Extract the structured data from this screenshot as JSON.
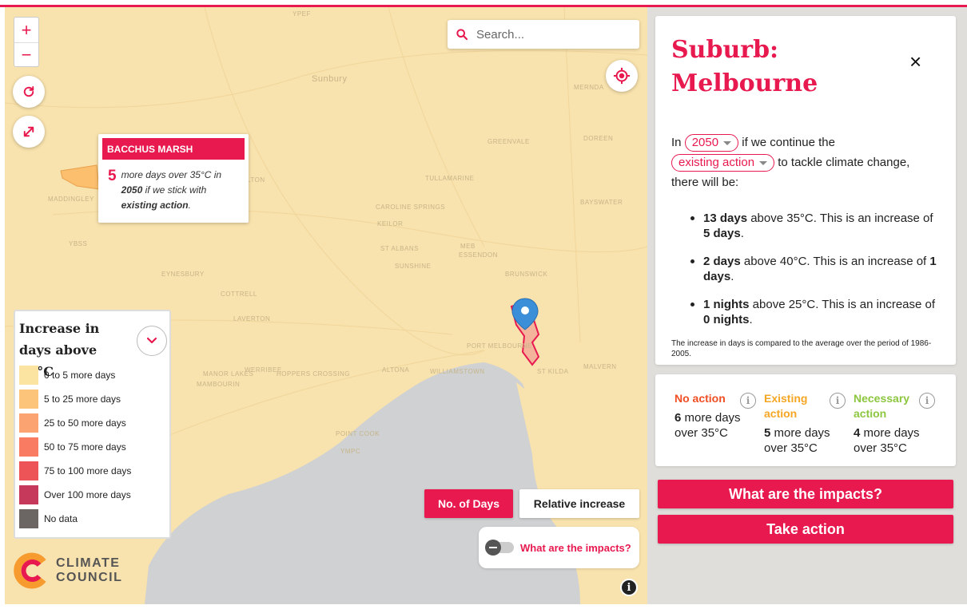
{
  "map": {
    "zoom_in": "+",
    "zoom_out": "−",
    "search_placeholder": "Search...",
    "place_labels": [
      "YPEF",
      "Sunbury",
      "Melton",
      "Caroline Springs",
      "Keilor",
      "Maddingley",
      "Bacchus",
      "Eynesbury",
      "Werribee",
      "Altona",
      "Mambourin",
      "Manor Lakes",
      "Hoppers Crossing",
      "Point Cook",
      "St Albans",
      "Sunshine",
      "Essendon",
      "Brunswick",
      "Malvern",
      "Port Melbourne",
      "Williamstown",
      "St Kilda",
      "Tullamarine",
      "Greenvale",
      "Mernda",
      "Doreen",
      "Cottrell",
      "Laverton",
      "Bayswater",
      "YMPC",
      "YBSS",
      "MEB"
    ],
    "popup": {
      "title": "BACCHUS MARSH",
      "number": "5",
      "text_pre": "more days over 35°C in ",
      "year": "2050",
      "text_mid": " if we stick with ",
      "action": "existing action",
      "text_end": "."
    },
    "legend": {
      "title": "Increase in days above 35°C",
      "items": [
        {
          "label": "0 to 5 more days",
          "color": "#fbe3a2"
        },
        {
          "label": "5 to 25 more days",
          "color": "#fbc47a"
        },
        {
          "label": "25 to 50 more days",
          "color": "#fba371"
        },
        {
          "label": "50 to 75 more days",
          "color": "#f97c62"
        },
        {
          "label": "75 to 100 more days",
          "color": "#ec5457"
        },
        {
          "label": "Over 100 more days",
          "color": "#c6395a"
        },
        {
          "label": "No data",
          "color": "#6b6563"
        }
      ]
    },
    "mode_buttons": {
      "active": "No. of Days",
      "inactive": "Relative increase"
    },
    "impacts_toggle_label": "What are the impacts?",
    "logo": {
      "line1": "CLIMATE",
      "line2": "COUNCIL"
    },
    "info": "i"
  },
  "panel": {
    "title": "Suburb: Melbourne",
    "close": "×",
    "sentence": {
      "in": "In",
      "year": "2050",
      "continue": "if we continue the",
      "action": "existing action",
      "tackle": "to tackle climate change,",
      "there": "there will be:"
    },
    "bullets": [
      {
        "bold1": "13 days",
        "text1": " above 35°C. This is an increase of ",
        "bold2": "5 days",
        "end": "."
      },
      {
        "bold1": "2 days",
        "text1": " above 40°C. This is an increase of ",
        "bold2": "1 days",
        "end": "."
      },
      {
        "bold1": "1 nights",
        "text1": " above 25°C. This is an increase of ",
        "bold2": "0 nights",
        "end": "."
      }
    ],
    "note": "The increase in days is compared to the average over the period of 1986-2005.",
    "scenarios": [
      {
        "name": "No action",
        "value": "6",
        "unit": " more days over 35°C",
        "color": "#f04e23"
      },
      {
        "name": "Existing action",
        "value": "5",
        "unit": " more days over 35°C",
        "color": "#f5a623"
      },
      {
        "name": "Necessary action",
        "value": "4",
        "unit": " more days over 35°C",
        "color": "#8dc63f"
      }
    ],
    "info_glyph": "i",
    "buttons": {
      "impacts": "What are the impacts?",
      "action": "Take action"
    }
  }
}
